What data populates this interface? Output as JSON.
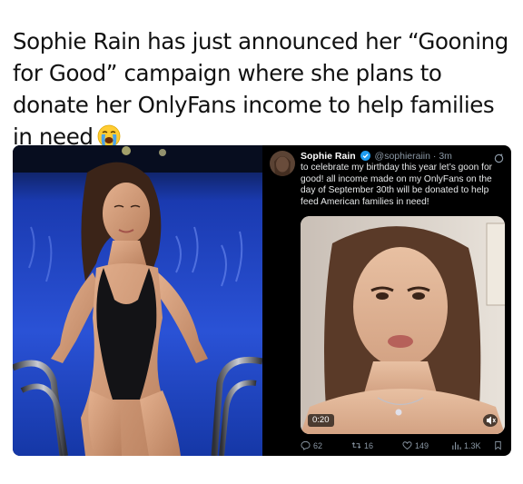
{
  "caption": {
    "text": "Sophie Rain has just announced her “Gooning for Good” campaign where she plans to donate her OnlyFans income to help families in need",
    "emoji": "loudly-crying-face-icon"
  },
  "tweet": {
    "name": "Sophie Rain",
    "handle": "@sophieraiin",
    "separator": "·",
    "time": "3m",
    "text": "to celebrate my birthday this year let’s goon for good! all income made on my OnlyFans on the day of September 30th will be donated to help feed American families in need!",
    "video": {
      "duration": "0:20"
    },
    "actions": {
      "replies": "62",
      "reposts": "16",
      "likes": "149",
      "views": "1.3K"
    }
  },
  "colors": {
    "tweet_bg": "#000000",
    "tweet_text": "#e7e9ea",
    "tweet_secondary": "#8b98a5",
    "verified": "#1d9bf0",
    "pool_blue": "#1d3fb8"
  }
}
